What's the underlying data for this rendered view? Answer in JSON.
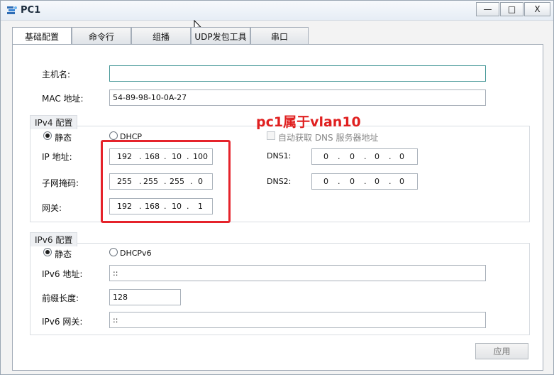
{
  "window": {
    "title": "PC1",
    "minimize": "—",
    "maximize": "□",
    "close": "X"
  },
  "tabs": [
    {
      "label": "基础配置"
    },
    {
      "label": "命令行"
    },
    {
      "label": "组播"
    },
    {
      "label": "UDP发包工具"
    },
    {
      "label": "串口"
    }
  ],
  "basic": {
    "hostname_label": "主机名:",
    "hostname_value": "",
    "mac_label": "MAC 地址:",
    "mac_value": "54-89-98-10-0A-27"
  },
  "ipv4": {
    "group_title": "IPv4 配置",
    "static_label": "静态",
    "dhcp_label": "DHCP",
    "auto_dns_label": "自动获取 DNS 服务器地址",
    "ip_label": "IP 地址:",
    "ip": [
      "192",
      "168",
      "10",
      "100"
    ],
    "mask_label": "子网掩码:",
    "mask": [
      "255",
      "255",
      "255",
      "0"
    ],
    "gateway_label": "网关:",
    "gateway": [
      "192",
      "168",
      "10",
      "1"
    ],
    "dns1_label": "DNS1:",
    "dns1": [
      "0",
      "0",
      "0",
      "0"
    ],
    "dns2_label": "DNS2:",
    "dns2": [
      "0",
      "0",
      "0",
      "0"
    ],
    "selected_mode": "static"
  },
  "ipv6": {
    "group_title": "IPv6 配置",
    "static_label": "静态",
    "dhcp_label": "DHCPv6",
    "ip_label": "IPv6 地址:",
    "ip_value": "::",
    "prefix_label": "前缀长度:",
    "prefix_value": "128",
    "gateway_label": "IPv6 网关:",
    "gateway_value": "::",
    "selected_mode": "static"
  },
  "annotation": {
    "text": "pc1属于vlan10",
    "color": "#e02020"
  },
  "apply_label": "应用",
  "icons": {
    "app": "network-pc-icon",
    "cursor": "mouse-cursor-icon"
  }
}
